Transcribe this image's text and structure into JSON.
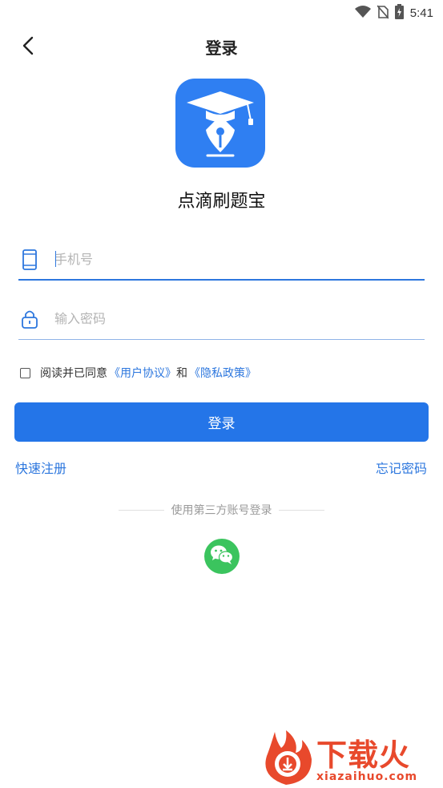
{
  "status_bar": {
    "time": "5:41",
    "icons": [
      "wifi-icon",
      "no-sim-icon",
      "battery-charging-icon"
    ]
  },
  "header": {
    "title": "登录",
    "back_icon": "chevron-left-icon"
  },
  "app": {
    "name": "点滴刷题宝",
    "logo_icon": "graduation-cap-pen-icon",
    "brand_color": "#2f7ff2"
  },
  "form": {
    "phone": {
      "placeholder": "手机号",
      "value": "",
      "icon": "phone-icon"
    },
    "password": {
      "placeholder": "输入密码",
      "value": "",
      "icon": "lock-icon"
    },
    "agreement": {
      "prefix": "阅读并已同意",
      "user_agreement": "《用户协议》",
      "and": "和",
      "privacy_policy": "《隐私政策》",
      "checked": false
    },
    "login_label": "登录"
  },
  "links": {
    "register": "快速注册",
    "forgot_password": "忘记密码"
  },
  "third_party": {
    "label": "使用第三方账号登录",
    "providers": [
      "wechat-icon"
    ]
  },
  "watermark": {
    "title": "下载火",
    "url": "xiazaihuo.com"
  },
  "colors": {
    "accent": "#2475e8",
    "link": "#2d77de",
    "wechat": "#3bc45e",
    "watermark": "#e8492c"
  }
}
